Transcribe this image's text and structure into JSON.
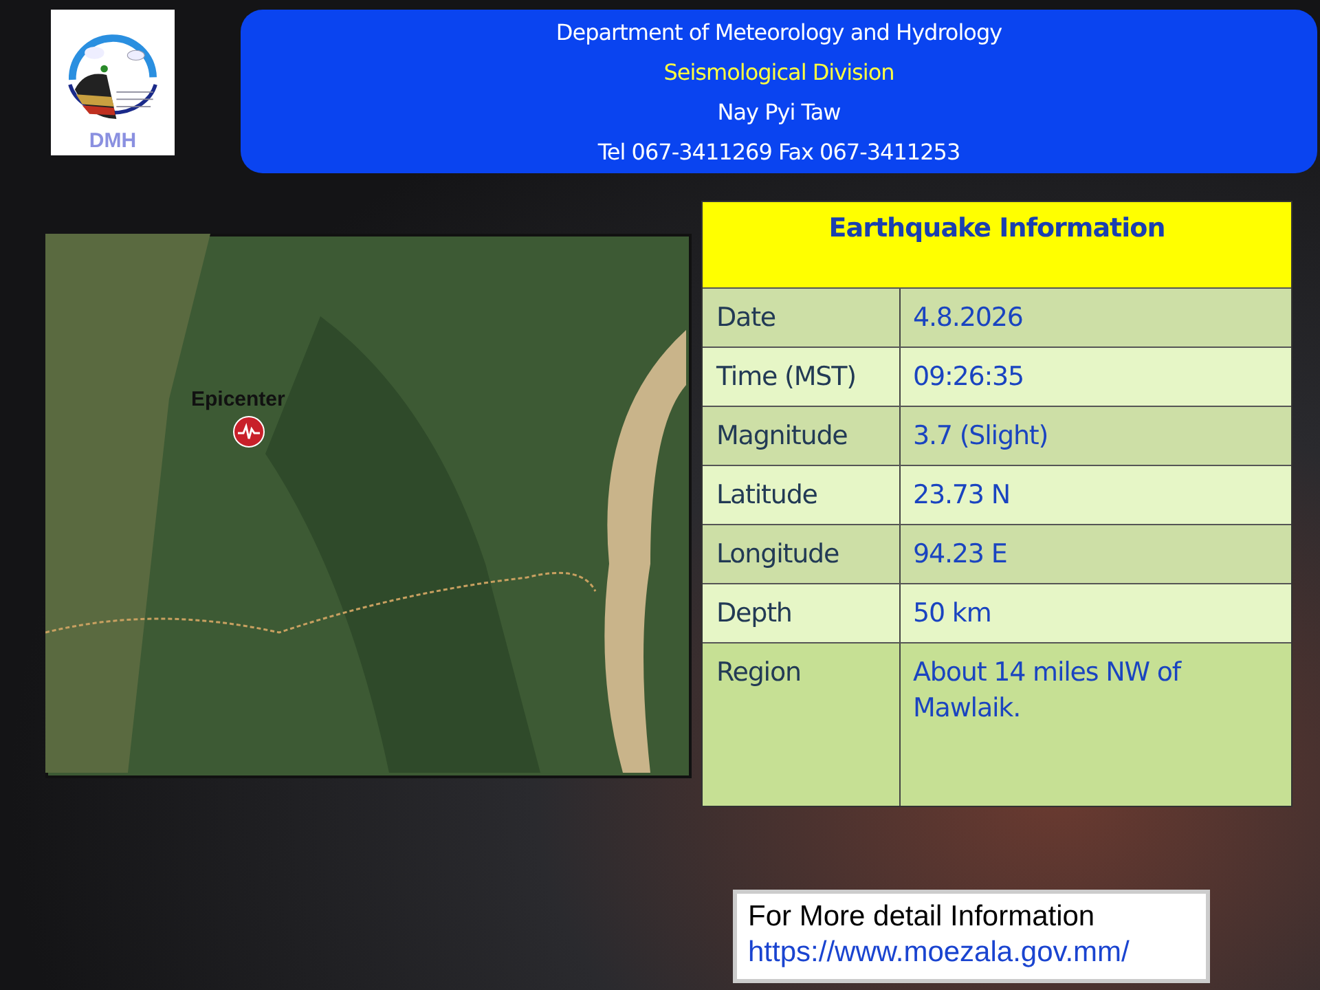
{
  "logo": {
    "text": "DMH"
  },
  "header": {
    "lines": [
      {
        "text": "Department of Meteorology and Hydrology",
        "kind": "plain"
      },
      {
        "text": "Seismological Division",
        "kind": "highlight"
      },
      {
        "text": "Nay Pyi Taw",
        "kind": "plain"
      },
      {
        "text": "Tel 067-3411269 Fax 067-3411253",
        "kind": "plain"
      }
    ]
  },
  "map": {
    "marker_label": "Epicenter"
  },
  "info_table": {
    "title": "Earthquake Information",
    "rows": [
      {
        "label": "Date",
        "value": "4.8.2026"
      },
      {
        "label": "Time (MST)",
        "value": "09:26:35"
      },
      {
        "label": "Magnitude",
        "value": "3.7 (Slight)"
      },
      {
        "label": "Latitude",
        "value": "23.73 N"
      },
      {
        "label": "Longitude",
        "value": "94.23 E"
      },
      {
        "label": "Depth",
        "value": "50 km"
      },
      {
        "label": "Region",
        "value": "About 14 miles NW of Mawlaik."
      }
    ]
  },
  "more_info": {
    "text": "For More detail Information",
    "link": "https://www.moezala.gov.mm/"
  }
}
